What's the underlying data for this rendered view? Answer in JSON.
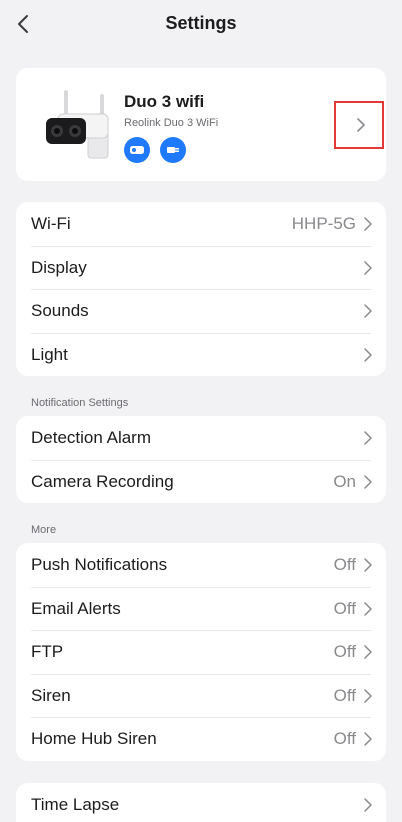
{
  "header": {
    "title": "Settings"
  },
  "device": {
    "name": "Duo 3 wifi",
    "model": "Reolink Duo 3 WiFi",
    "badges": [
      "camera-badge-icon",
      "plug-badge-icon"
    ],
    "accent": "#1f7aff",
    "highlight_color": "#e53935"
  },
  "group_main": {
    "rows": [
      {
        "label": "Wi-Fi",
        "value": "HHP-5G"
      },
      {
        "label": "Display",
        "value": ""
      },
      {
        "label": "Sounds",
        "value": ""
      },
      {
        "label": "Light",
        "value": ""
      }
    ]
  },
  "notification_section": {
    "title": "Notification Settings",
    "rows": [
      {
        "label": "Detection Alarm",
        "value": ""
      },
      {
        "label": "Camera Recording",
        "value": "On"
      }
    ]
  },
  "more_section": {
    "title": "More",
    "rows": [
      {
        "label": "Push Notifications",
        "value": "Off"
      },
      {
        "label": "Email Alerts",
        "value": "Off"
      },
      {
        "label": "FTP",
        "value": "Off"
      },
      {
        "label": "Siren",
        "value": "Off"
      },
      {
        "label": "Home Hub Siren",
        "value": "Off"
      }
    ]
  },
  "group_last": {
    "rows": [
      {
        "label": "Time Lapse",
        "value": ""
      }
    ]
  }
}
